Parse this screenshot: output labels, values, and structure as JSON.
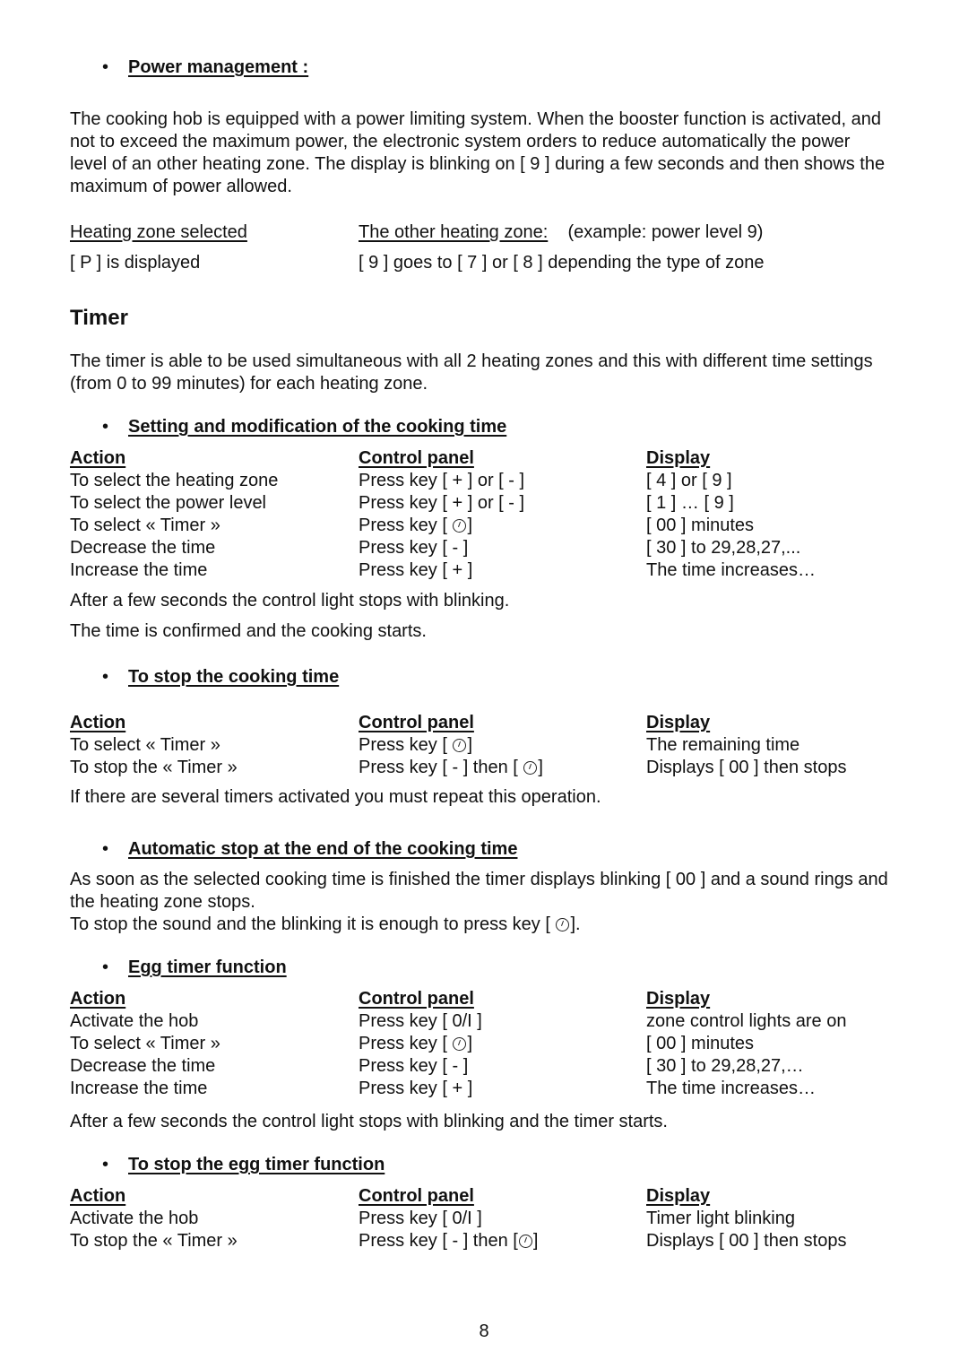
{
  "power_management": {
    "heading": "Power management :",
    "paragraph": "The cooking hob is equipped with a power limiting system. When the booster function is activated, and not to exceed the maximum power, the electronic system orders to reduce automatically the power level of an other heating zone. The display is blinking on [ 9 ] during a few seconds and then shows the maximum of power allowed.",
    "col1_header": "Heating zone selected",
    "col2_header": "The other heating zone:",
    "col2_note": "(example: power  level 9)",
    "col1_value": "[ P ] is displayed",
    "col2_value": "[ 9 ] goes to [ 7 ] or [ 8 ] depending the type of zone"
  },
  "timer": {
    "title": "Timer",
    "intro": "The timer is able to be used simultaneous with all 2 heating zones and this with different time settings (from 0 to 99 minutes) for each heating zone.",
    "headers": {
      "action": "Action",
      "control": "Control panel",
      "display": "Display"
    },
    "setting": {
      "heading": "Setting and modification of the cooking time",
      "rows": [
        {
          "action": "To select the heating zone",
          "control": "Press key [ + ] or [ - ]",
          "display": "[ 4 ] or [ 9 ]"
        },
        {
          "action": "To select the power level",
          "control": "Press key [ + ] or [ - ]",
          "display": "[ 1 ] … [ 9 ]"
        },
        {
          "action": "To select « Timer »",
          "control_pre": "Press key [ ",
          "control_post": "]",
          "display": "[ 00 ] minutes"
        },
        {
          "action": "Decrease the time",
          "control": "Press key [ - ]",
          "display": "[ 30 ] to 29,28,27,..."
        },
        {
          "action": "Increase the time",
          "control": "Press key [ + ]",
          "display": "The time increases…"
        }
      ],
      "note1": "After a few seconds the control light stops with blinking.",
      "note2": "The time is confirmed and the cooking starts."
    },
    "stop": {
      "heading": "To stop the cooking time",
      "rows": [
        {
          "action": "To select « Timer »",
          "control_pre": "Press key [ ",
          "control_post": "]",
          "display": "The remaining time"
        },
        {
          "action": "To stop the « Timer »",
          "control_pre": "Press key [ - ] then [ ",
          "control_post": "]",
          "display": "Displays [ 00 ] then stops"
        }
      ],
      "note": "If there are several timers activated you must repeat this operation."
    },
    "auto_stop": {
      "heading": "Automatic stop at the end of the cooking time",
      "text1": "As soon as the selected cooking time is finished the timer displays blinking [ 00 ] and a sound rings and the heating zone stops.",
      "text2_pre": "To stop the sound and the blinking it is enough to press key [ ",
      "text2_post": "]."
    },
    "egg": {
      "heading": "Egg timer function",
      "rows": [
        {
          "action": "Activate the hob",
          "control": "Press key [ 0/I ]",
          "display": "zone control lights are on"
        },
        {
          "action": "To select « Timer »",
          "control_pre": "Press key [ ",
          "control_post": "]",
          "display": "[ 00 ] minutes"
        },
        {
          "action": "Decrease the time",
          "control": "Press key [ - ]",
          "display": "[ 30 ] to 29,28,27,…"
        },
        {
          "action": "Increase the time",
          "control": "Press key [ + ]",
          "display": "The time increases…"
        }
      ],
      "note": "After a few seconds the control light stops with blinking and the timer starts."
    },
    "egg_stop": {
      "heading": "To stop the egg timer function",
      "rows": [
        {
          "action": "Activate the hob",
          "control": "Press key [ 0/I ]",
          "display": "Timer light blinking"
        },
        {
          "action": "To stop the « Timer »",
          "control_pre": "Press key [ - ] then [",
          "control_post": "]",
          "display": "Displays [ 00 ] then stops"
        }
      ]
    }
  },
  "page_number": "8"
}
